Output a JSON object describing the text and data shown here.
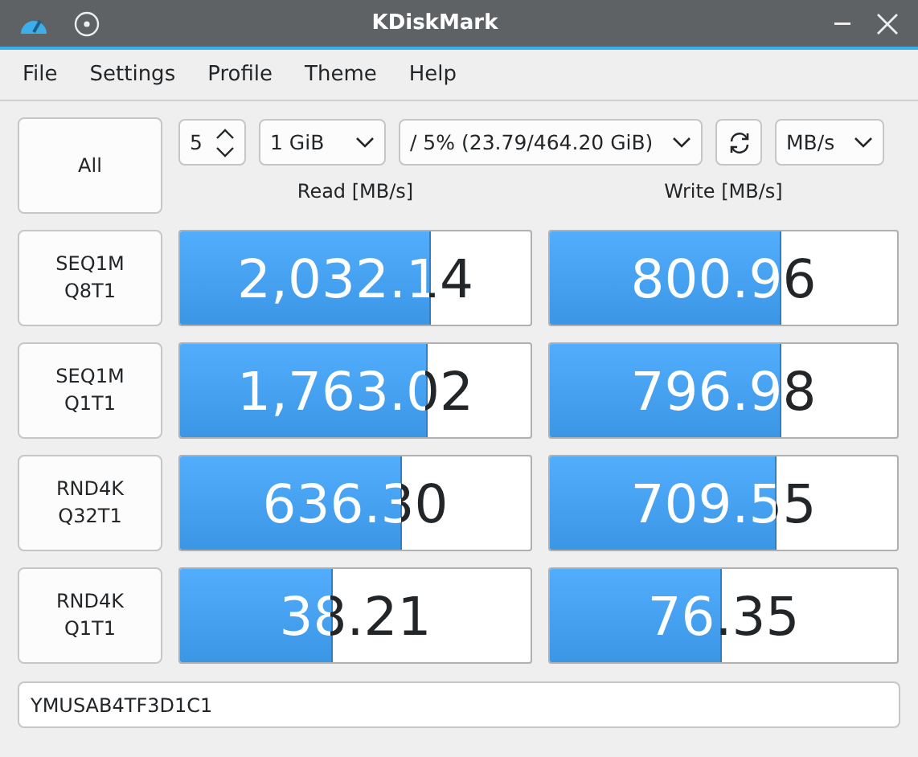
{
  "window": {
    "title": "KDiskMark"
  },
  "menu": [
    "File",
    "Settings",
    "Profile",
    "Theme",
    "Help"
  ],
  "toolbar": {
    "all_button": "All",
    "runs": "5",
    "size": "1 GiB",
    "target": "/ 5% (23.79/464.20 GiB)",
    "unit": "MB/s"
  },
  "headers": {
    "read": "Read [MB/s]",
    "write": "Write [MB/s]"
  },
  "tests": [
    {
      "label": "SEQ1M\nQ8T1",
      "read": {
        "value": "2,032.14",
        "level": 0.71
      },
      "write": {
        "value": "800.96",
        "level": 0.66
      }
    },
    {
      "label": "SEQ1M\nQ1T1",
      "read": {
        "value": "1,763.02",
        "level": 0.7
      },
      "write": {
        "value": "796.98",
        "level": 0.66
      }
    },
    {
      "label": "RND4K\nQ32T1",
      "read": {
        "value": "636.30",
        "level": 0.63
      },
      "write": {
        "value": "709.55",
        "level": 0.65
      }
    },
    {
      "label": "RND4K\nQ1T1",
      "read": {
        "value": "38.21",
        "level": 0.43
      },
      "write": {
        "value": "76.35",
        "level": 0.49
      }
    }
  ],
  "device": {
    "value": "YMUSAB4TF3D1C1"
  }
}
